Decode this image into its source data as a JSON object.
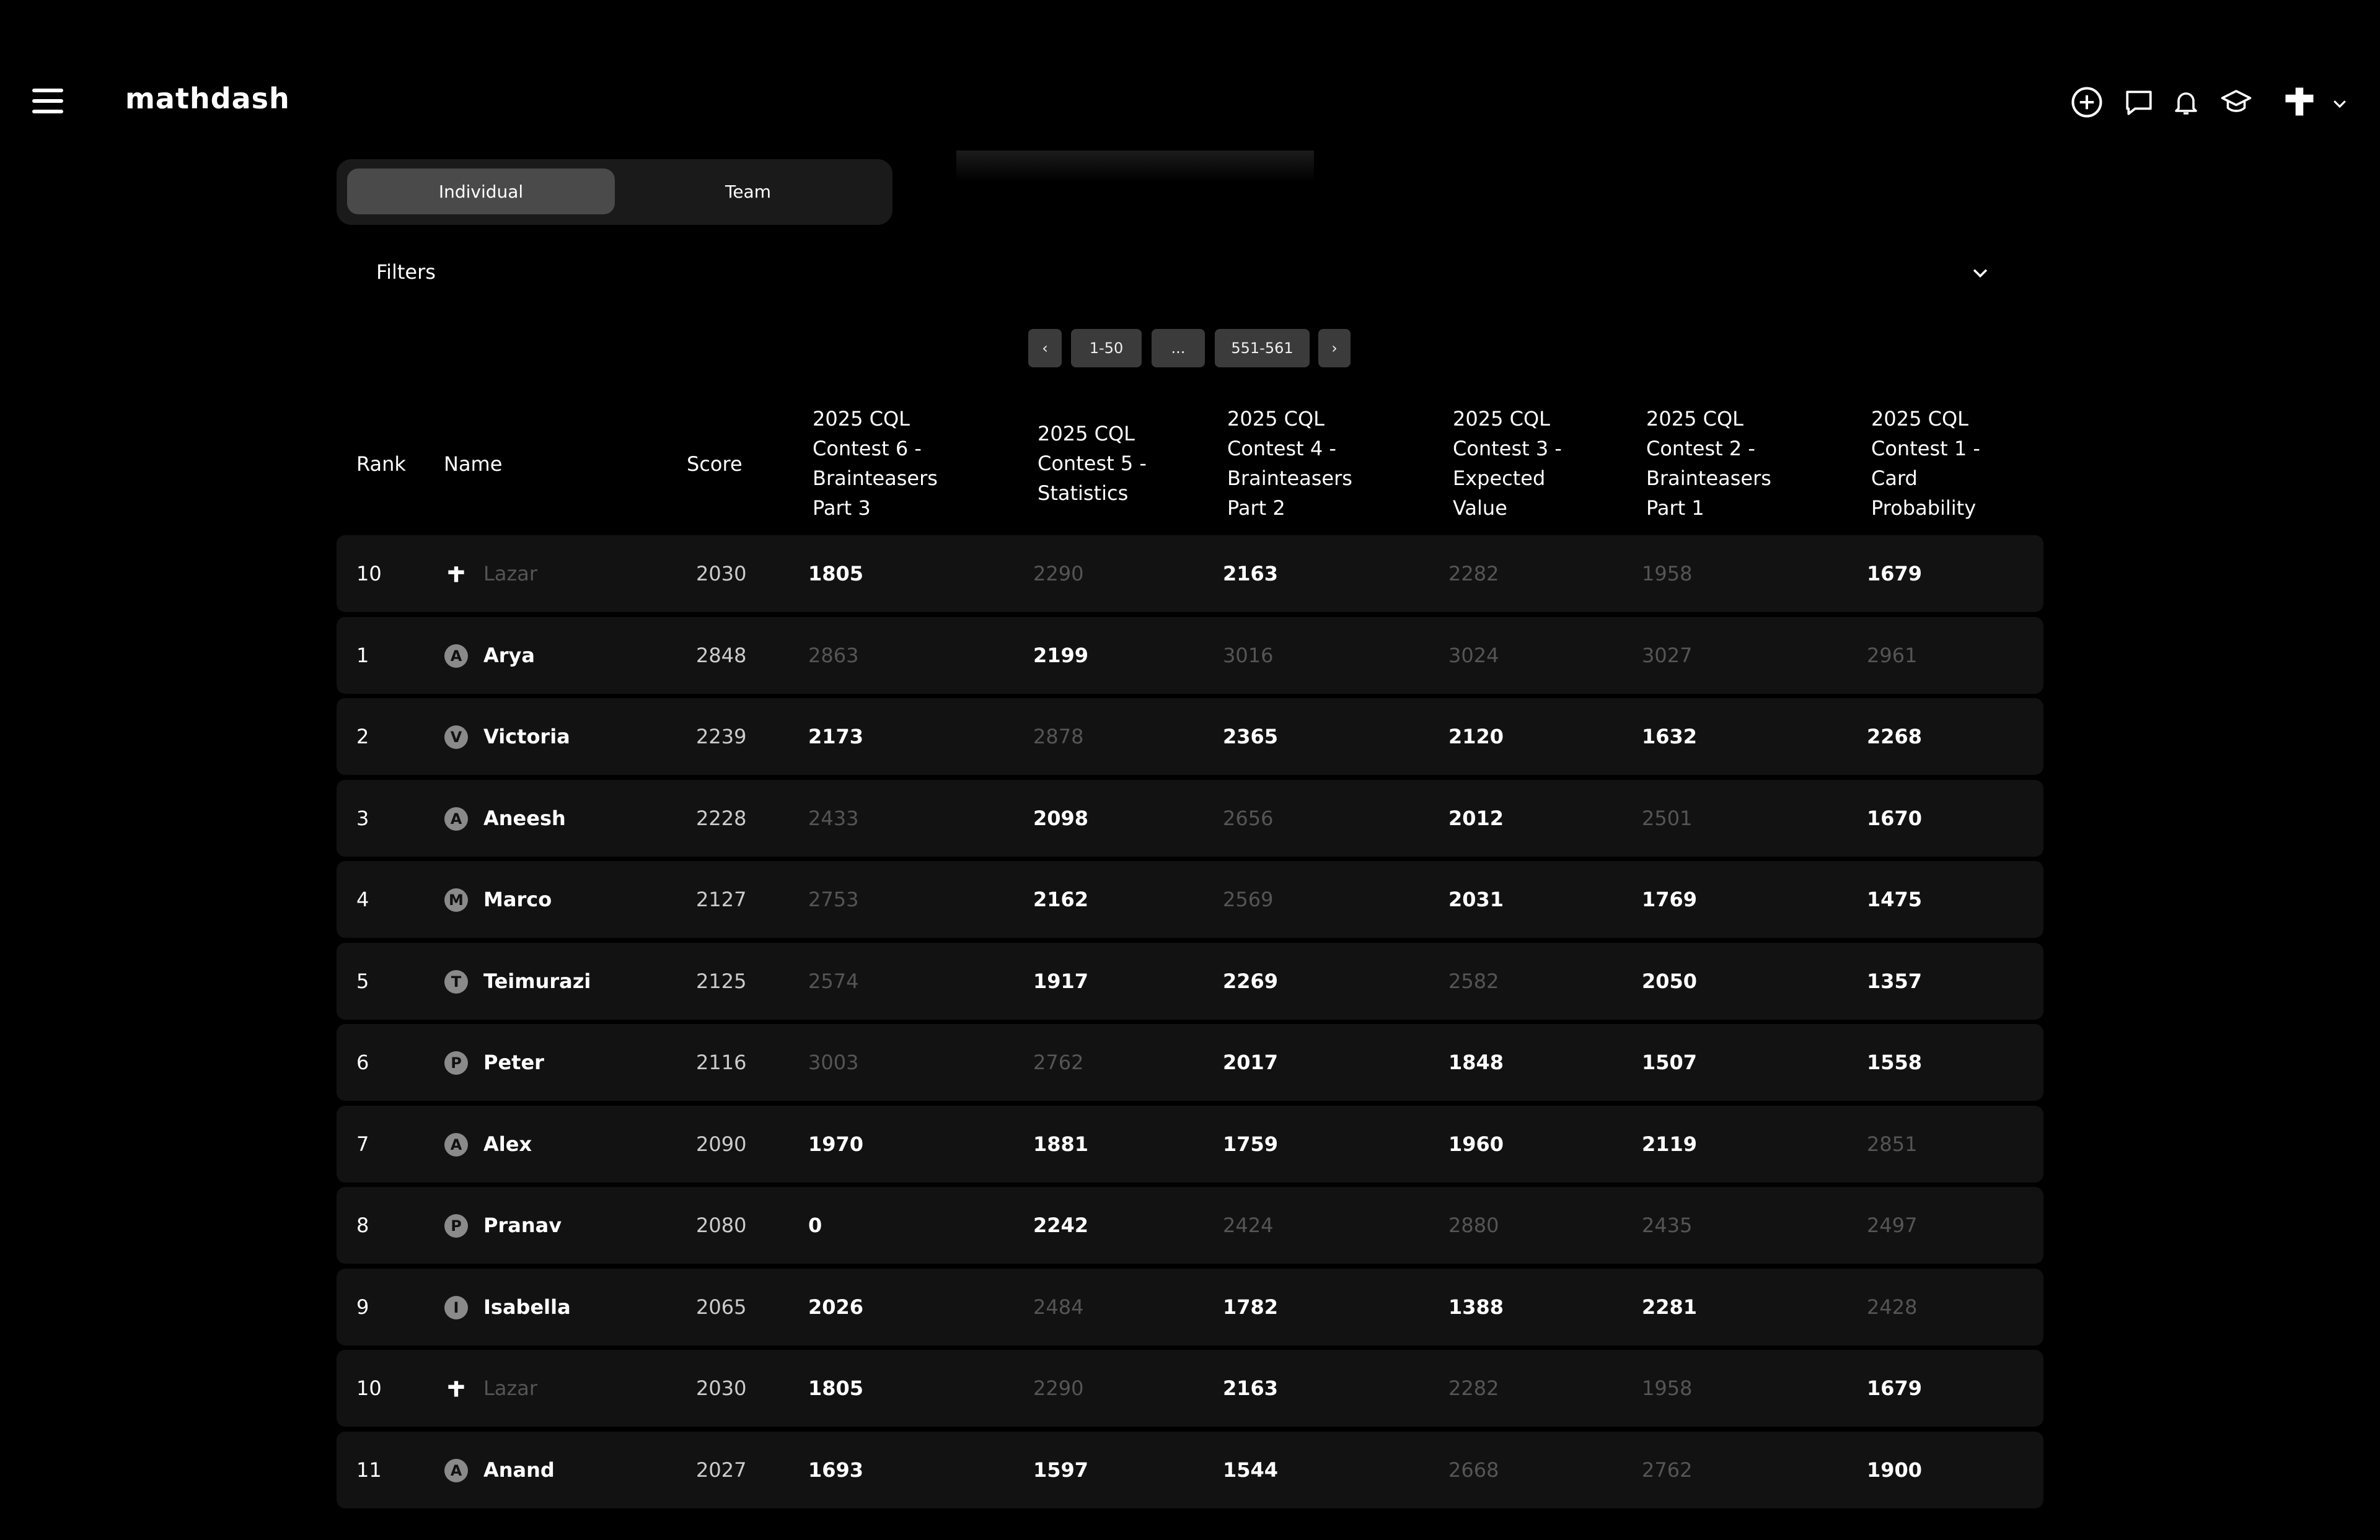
{
  "app": {
    "logo": "mathdash"
  },
  "header": {
    "icons": [
      "add-circle-icon",
      "chat-icon",
      "bell-icon",
      "graduation-cap-icon"
    ],
    "avatar": "flag-avatar"
  },
  "toggle": {
    "individual": "Individual",
    "team": "Team",
    "active": "Individual"
  },
  "filters": {
    "label": "Filters"
  },
  "pagination": {
    "prev": "‹",
    "first": "1-50",
    "dots": "...",
    "last": "551-561",
    "next": "›"
  },
  "table": {
    "headers": {
      "rank": "Rank",
      "name": "Name",
      "score": "Score",
      "c6": [
        "2025 CQL",
        "Contest 6 -",
        "Brainteasers",
        "Part 3"
      ],
      "c5": [
        "2025 CQL",
        "Contest 5 -",
        "Statistics"
      ],
      "c4": [
        "2025 CQL",
        "Contest 4 -",
        "Brainteasers",
        "Part 2"
      ],
      "c3": [
        "2025 CQL",
        "Contest 3 -",
        "Expected",
        "Value"
      ],
      "c2": [
        "2025 CQL",
        "Contest 2 -",
        "Brainteasers",
        "Part 1"
      ],
      "c1": [
        "2025 CQL",
        "Contest 1 -",
        "Card",
        "Probability"
      ]
    },
    "rows": [
      {
        "rank": "10",
        "avatar": "",
        "name": "Lazar",
        "self": true,
        "score": "2030",
        "c6": "1805",
        "c5": "2290",
        "c4": "2163",
        "c3": "2282",
        "c2": "1958",
        "c1": "1679",
        "dim": [
          "c5",
          "c3",
          "c2"
        ]
      },
      {
        "rank": "1",
        "avatar": "A",
        "name": "Arya",
        "score": "2848",
        "c6": "2863",
        "c5": "2199",
        "c4": "3016",
        "c3": "3024",
        "c2": "3027",
        "c1": "2961",
        "dim": [
          "c6",
          "c4",
          "c3",
          "c2",
          "c1"
        ]
      },
      {
        "rank": "2",
        "avatar": "V",
        "name": "Victoria",
        "score": "2239",
        "c6": "2173",
        "c5": "2878",
        "c4": "2365",
        "c3": "2120",
        "c2": "1632",
        "c1": "2268",
        "dim": [
          "c5"
        ]
      },
      {
        "rank": "3",
        "avatar": "A",
        "name": "Aneesh",
        "score": "2228",
        "c6": "2433",
        "c5": "2098",
        "c4": "2656",
        "c3": "2012",
        "c2": "2501",
        "c1": "1670",
        "dim": [
          "c6",
          "c4",
          "c2"
        ]
      },
      {
        "rank": "4",
        "avatar": "M",
        "name": "Marco",
        "score": "2127",
        "c6": "2753",
        "c5": "2162",
        "c4": "2569",
        "c3": "2031",
        "c2": "1769",
        "c1": "1475",
        "dim": [
          "c6",
          "c4"
        ]
      },
      {
        "rank": "5",
        "avatar": "T",
        "name": "Teimurazi",
        "score": "2125",
        "c6": "2574",
        "c5": "1917",
        "c4": "2269",
        "c3": "2582",
        "c2": "2050",
        "c1": "1357",
        "dim": [
          "c6",
          "c3"
        ]
      },
      {
        "rank": "6",
        "avatar": "P",
        "name": "Peter",
        "score": "2116",
        "c6": "3003",
        "c5": "2762",
        "c4": "2017",
        "c3": "1848",
        "c2": "1507",
        "c1": "1558",
        "dim": [
          "c6",
          "c5"
        ]
      },
      {
        "rank": "7",
        "avatar": "A",
        "name": "Alex",
        "score": "2090",
        "c6": "1970",
        "c5": "1881",
        "c4": "1759",
        "c3": "1960",
        "c2": "2119",
        "c1": "2851",
        "dim": [
          "c1"
        ]
      },
      {
        "rank": "8",
        "avatar": "P",
        "name": "Pranav",
        "score": "2080",
        "c6": "0",
        "c5": "2242",
        "c4": "2424",
        "c3": "2880",
        "c2": "2435",
        "c1": "2497",
        "dim": [
          "c4",
          "c3",
          "c2",
          "c1"
        ]
      },
      {
        "rank": "9",
        "avatar": "I",
        "name": "Isabella",
        "score": "2065",
        "c6": "2026",
        "c5": "2484",
        "c4": "1782",
        "c3": "1388",
        "c2": "2281",
        "c1": "2428",
        "dim": [
          "c5",
          "c1"
        ]
      },
      {
        "rank": "10",
        "avatar": "",
        "name": "Lazar",
        "self": true,
        "score": "2030",
        "c6": "1805",
        "c5": "2290",
        "c4": "2163",
        "c3": "2282",
        "c2": "1958",
        "c1": "1679",
        "dim": [
          "c5",
          "c3",
          "c2"
        ]
      },
      {
        "rank": "11",
        "avatar": "A",
        "name": "Anand",
        "score": "2027",
        "c6": "1693",
        "c5": "1597",
        "c4": "1544",
        "c3": "2668",
        "c2": "2762",
        "c1": "1900",
        "dim": [
          "c3",
          "c2"
        ]
      }
    ]
  },
  "colors": {
    "background": "#000000",
    "row": "#121212",
    "dim_text": "#555555",
    "active_toggle": "#4a4a4a"
  }
}
